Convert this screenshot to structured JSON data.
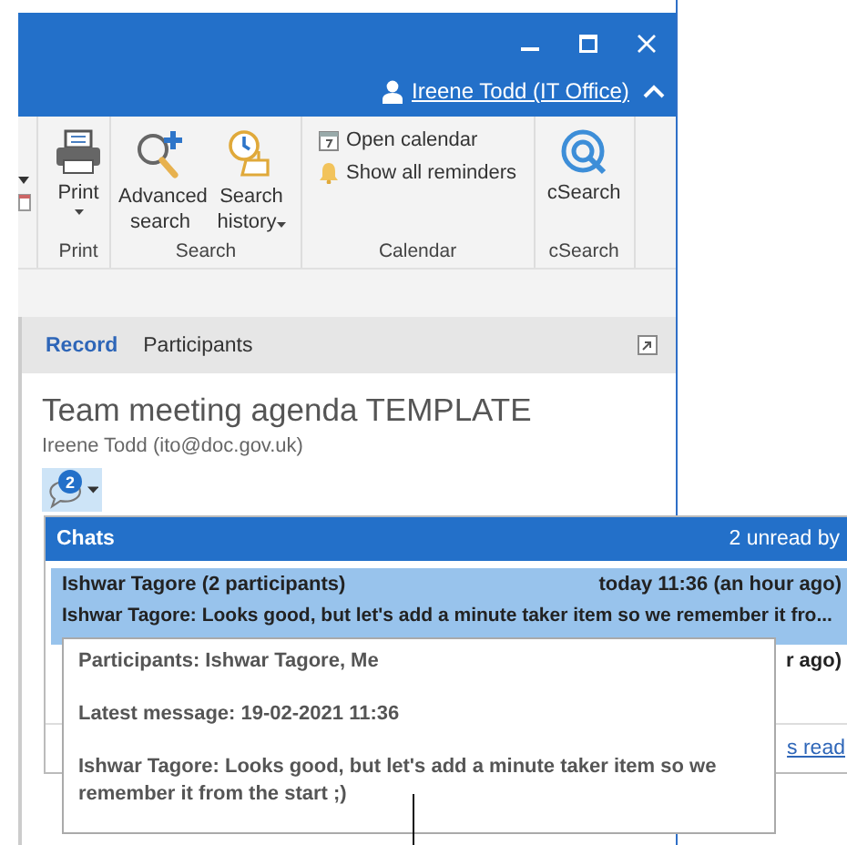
{
  "user": {
    "name": "Ireene Todd (IT Office)"
  },
  "ribbon": {
    "groups": [
      {
        "label": "Print",
        "items": [
          {
            "kind": "large",
            "label": "Print",
            "dropdown": true
          }
        ]
      },
      {
        "label": "Search",
        "items": [
          {
            "kind": "large",
            "label": "Advanced search",
            "dropdown": false
          },
          {
            "kind": "large",
            "label": "Search history",
            "dropdown": true
          }
        ]
      },
      {
        "label": "Calendar",
        "items": [
          {
            "kind": "small",
            "label": "Open calendar"
          },
          {
            "kind": "small",
            "label": "Show all reminders"
          }
        ]
      },
      {
        "label": "cSearch",
        "items": [
          {
            "kind": "large",
            "label": "cSearch",
            "dropdown": false
          }
        ]
      }
    ]
  },
  "tabs": [
    {
      "label": "Record",
      "selected": true
    },
    {
      "label": "Participants",
      "selected": false
    }
  ],
  "record": {
    "title": "Team meeting agenda TEMPLATE",
    "author": "Ireene Todd (ito@doc.gov.uk)"
  },
  "chat_button": {
    "count": "2"
  },
  "chats_popup": {
    "title": "Chats",
    "summary": "2 unread by",
    "rows": [
      {
        "title": "Ishwar Tagore (2 participants)",
        "time": "today 11:36 (an hour ago)",
        "preview": "Ishwar Tagore: Looks good, but let's add a minute taker item so we remember it fro...",
        "selected": true
      },
      {
        "time": "r ago)",
        "selected": false
      }
    ],
    "link": "s read"
  },
  "tooltip": {
    "lines": [
      "Participants: Ishwar Tagore, Me",
      "Latest message: 19-02-2021 11:36",
      "Ishwar Tagore: Looks good, but let's add a minute taker item so we remember it from the start ;)"
    ]
  }
}
